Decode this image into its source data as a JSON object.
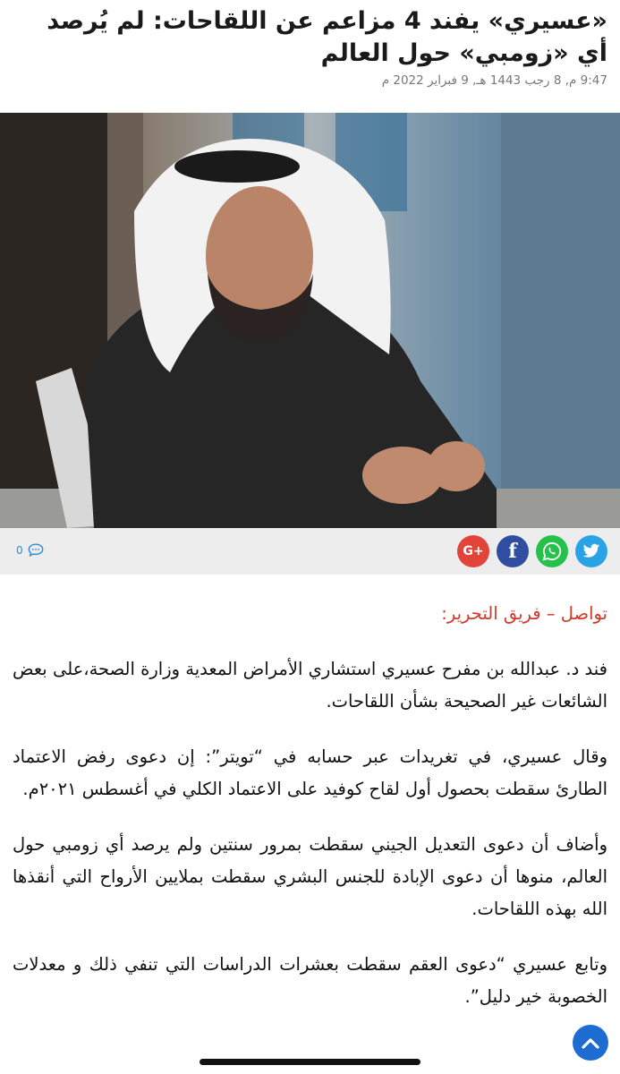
{
  "article": {
    "title": "«عسيري» يفند 4 مزاعم عن اللقاحات: لم يُرصد أي «زومبي» حول العالم",
    "meta": "9:47 م, 8 رجب 1443 هـ, 9 فبراير 2022 م",
    "byline": "تواصل – فريق التحرير:",
    "paragraphs": [
      "فند د. عبدالله بن مفرح عسيري استشاري الأمراض المعدية وزارة الصحة،على بعض الشائعات غير الصحيحة بشأن اللقاحات.",
      "وقال عسيري، في تغريدات عبر حسابه في “تويتر”: إن دعوى رفض الاعتماد الطارئ سقطت بحصول أول لقاح كوفيد على الاعتماد الكلي في أغسطس ٢٠٢١م.",
      "وأضاف أن دعوى التعديل الجيني سقطت بمرور سنتين ولم يرصد أي زومبي حول العالم، منوها أن دعوى الإبادة للجنس البشري سقطت بملايين الأرواح التي أنقذها الله بهذه اللقاحات.",
      "وتابع عسيري “دعوى العقم سقطت بعشرات الدراسات التي تنفي ذلك و معدلات الخصوبة خير دليل”."
    ]
  },
  "share": {
    "twitter_icon": "twitter-icon",
    "whatsapp_icon": "whatsapp-icon",
    "facebook_label": "f",
    "google_label": "G+",
    "comment_count": "0",
    "comment_icon": "comment-bubble-icon"
  },
  "colors": {
    "byline": "#d23b2a",
    "twitter": "#2aa3e6",
    "whatsapp": "#25c24b",
    "facebook": "#2f4ea0",
    "google": "#e2443a",
    "scroll_top": "#1e6bd2"
  }
}
